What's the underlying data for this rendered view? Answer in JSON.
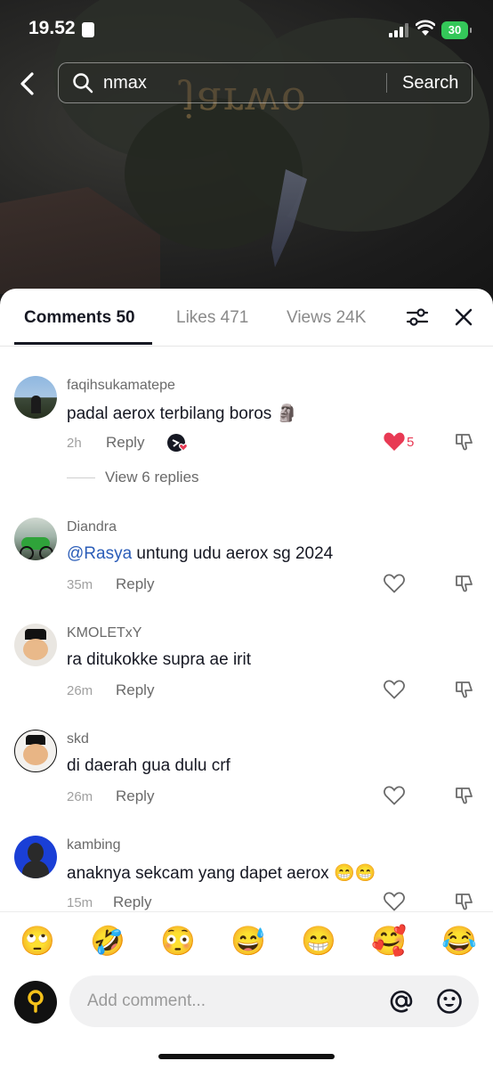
{
  "status_bar": {
    "time": "19.52",
    "battery": "30"
  },
  "search": {
    "query": "nmax",
    "button_label": "Search"
  },
  "background": {
    "logo_text": "jarwo"
  },
  "tabs": [
    {
      "label": "Comments 50",
      "active": true
    },
    {
      "label": "Likes 471",
      "active": false
    },
    {
      "label": "Views 24K",
      "active": false
    }
  ],
  "comments": [
    {
      "user": "faqihsukamatepe",
      "text": "padal aerox terbilang boros 🗿",
      "time": "2h",
      "reply_label": "Reply",
      "likes": "5",
      "liked": true,
      "view_replies": "View 6 replies"
    },
    {
      "user": "Diandra",
      "mention": "@Rasya",
      "text": " untung udu aerox sg 2024",
      "time": "35m",
      "reply_label": "Reply"
    },
    {
      "user": "KMOLETxY",
      "text": "ra ditukokke supra ae irit",
      "time": "26m",
      "reply_label": "Reply"
    },
    {
      "user": "skd",
      "text": "di daerah gua dulu crf",
      "time": "26m",
      "reply_label": "Reply"
    },
    {
      "user": "kambing",
      "text": "anaknya sekcam yang dapet aerox 😁😁",
      "time": "15m",
      "reply_label": "Reply"
    }
  ],
  "quick_emojis": [
    "🙄",
    "🤣",
    "😳",
    "😅",
    "😁",
    "🥰",
    "😂"
  ],
  "composer": {
    "placeholder": "Add comment..."
  },
  "colors": {
    "like_red": "#e83a54",
    "mention_blue": "#2b5db8",
    "battery_green": "#34c759"
  }
}
